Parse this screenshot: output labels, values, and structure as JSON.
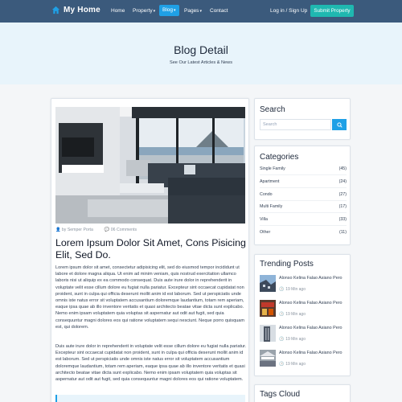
{
  "navbar": {
    "brand": "My Home",
    "items": [
      {
        "label": "Home",
        "caret": ""
      },
      {
        "label": "Property",
        "caret": "▾"
      },
      {
        "label": "Blog",
        "caret": "▾"
      },
      {
        "label": "Pages",
        "caret": "▾"
      },
      {
        "label": "Contact",
        "caret": ""
      }
    ],
    "active_item": "Blog",
    "login_label": "Log in / Sign Up",
    "submit_label": "Submit Property",
    "colors": {
      "bar": "#3b5a7c",
      "active": "#1fa0e6",
      "submit": "#1fb8b0"
    }
  },
  "hero": {
    "title": "Blog Detail",
    "subtitle": "See Our Latest Articles & News"
  },
  "post": {
    "image_icon": "living-room-photo",
    "author": "by Semper Porta",
    "comments": "06 Comments",
    "title": "Lorem Ipsum Dolor Sit Amet, Cons Pisicing Elit, Sed Do.",
    "paragraph1": "Lorem ipsum dolor sit amet, consectetur adipisicing elit, sed do eiusmod tempor incididunt ut labore et dolore magna aliqua. Ut enim ad minim veniam, quis nostrud exercitation ullamco laboris nisi ut aliquip ex ea commodo consequat. Duis aute irure dolor in reprehenderit in voluptate velit esse cillum dolore eu fugiat nulla pariatur. Excepteur sint occaecat cupidatat non proident, sunt in culpa qui officia deserunt mollit anim id est laborum. Sed ut perspiciatis unde omnis iste natus error sit voluptatem accusantium doloremque laudantium, totam rem aperiam, eaque ipsa quae ab illo inventore veritatis et quasi architecto beatae vitae dicta sunt explicabo. Nemo enim ipsam voluptatem quia voluptas sit aspernatur aut odit aut fugit, sed quia consequuntur magni dolores eos qui ratione voluptatem sequi nesciunt. Neque porro quisquam est, qui dolorem.",
    "paragraph2": "Duis aute irure dolor in reprehenderit in voluptate velit esse cillum dolore eu fugiat nulla pariatur. Excepteur sint occaecat cupidatat non proident, sunt in culpa qui officia deserunt mollit anim id est laborum. Sed ut perspiciatis unde omnis iste natus error sit voluptatem accusantium doloremque laudantium, totam rem aperiam, eaque ipsa quae ab illo inventore veritatis et quasi architecto beatae vitae dicta sunt explicabo. Nemo enim ipsam voluptatem quia voluptas sit aspernatur aut odit aut fugit, sed quia consequuntur magni dolores eos qui ratione voluptatem."
  },
  "sidebar": {
    "search": {
      "title": "Search",
      "placeholder": "Search",
      "button_icon": "search-icon"
    },
    "categories": {
      "title": "Categories",
      "items": [
        {
          "label": "Single Family",
          "count": "(45)"
        },
        {
          "label": "Apartment",
          "count": "(24)"
        },
        {
          "label": "Condo",
          "count": "(27)"
        },
        {
          "label": "Multi Family",
          "count": "(17)"
        },
        {
          "label": "Villa",
          "count": "(33)"
        },
        {
          "label": "Other",
          "count": "(11)"
        }
      ]
    },
    "trending": {
      "title": "Trending Posts",
      "items": [
        {
          "title": "Alonso Kelina Falao Asiano Pero",
          "time": "19 Min ago",
          "thumb_icon": "building-photo"
        },
        {
          "title": "Alonso Kelina Falao Asiano Pero",
          "time": "19 Min ago",
          "thumb_icon": "store-photo"
        },
        {
          "title": "Alonso Kelina Falao Asiano Pero",
          "time": "19 Min ago",
          "thumb_icon": "tower-photo"
        },
        {
          "title": "Alonso Kelina Falao Asiano Pero",
          "time": "19 Min ago",
          "thumb_icon": "station-photo"
        }
      ]
    },
    "tags": {
      "title": "Tags Cloud"
    }
  }
}
